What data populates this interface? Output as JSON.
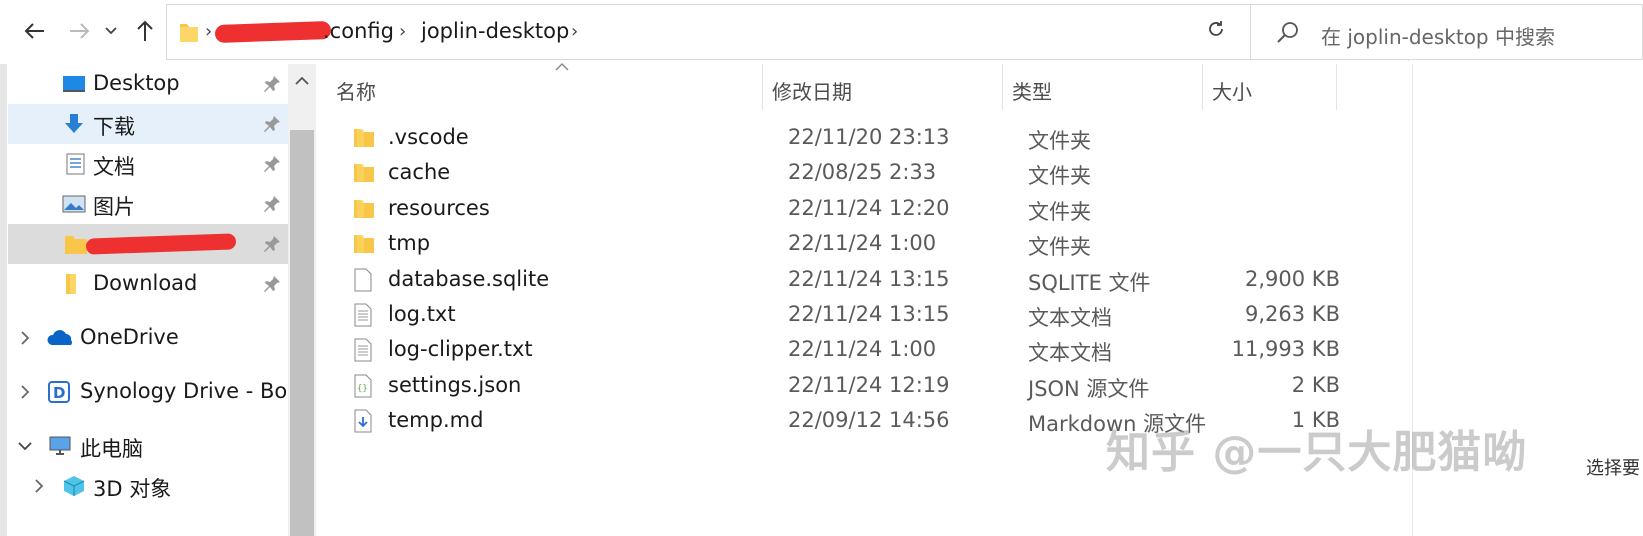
{
  "address_bar": {
    "breadcrumbs": [
      ".config",
      "joplin-desktop"
    ],
    "search_placeholder": "在 joplin-desktop 中搜索"
  },
  "sidebar": {
    "quick_access": [
      {
        "label": "Desktop",
        "icon": "desktop-icon",
        "pinned": true
      },
      {
        "label": "下载",
        "icon": "download-arrow-icon",
        "pinned": true,
        "selected": true
      },
      {
        "label": "文档",
        "icon": "document-icon",
        "pinned": true
      },
      {
        "label": "图片",
        "icon": "picture-icon",
        "pinned": true
      },
      {
        "label": "",
        "icon": "folder-icon",
        "pinned": true,
        "redacted": true
      },
      {
        "label": "Download",
        "icon": "folder-icon",
        "pinned": true
      }
    ],
    "locations": [
      {
        "label": "OneDrive",
        "icon": "onedrive-cloud-icon",
        "expanded": false
      },
      {
        "label": "Synology Drive - Bor",
        "icon": "synology-drive-icon",
        "expanded": false
      },
      {
        "label": "此电脑",
        "icon": "computer-icon",
        "expanded": true
      },
      {
        "label": "3D 对象",
        "icon": "3d-objects-icon",
        "expanded": false
      }
    ]
  },
  "file_list": {
    "columns": {
      "name": "名称",
      "date": "修改日期",
      "type": "类型",
      "size": "大小"
    },
    "rows": [
      {
        "name": ".vscode",
        "date": "22/11/20 23:13",
        "type": "文件夹",
        "size": "",
        "icon": "folder-icon"
      },
      {
        "name": "cache",
        "date": "22/08/25 2:33",
        "type": "文件夹",
        "size": "",
        "icon": "folder-icon"
      },
      {
        "name": "resources",
        "date": "22/11/24 12:20",
        "type": "文件夹",
        "size": "",
        "icon": "folder-icon"
      },
      {
        "name": "tmp",
        "date": "22/11/24 1:00",
        "type": "文件夹",
        "size": "",
        "icon": "folder-icon"
      },
      {
        "name": "database.sqlite",
        "date": "22/11/24 13:15",
        "type": "SQLITE 文件",
        "size": "2,900 KB",
        "icon": "blank-file-icon"
      },
      {
        "name": "log.txt",
        "date": "22/11/24 13:15",
        "type": "文本文档",
        "size": "9,263 KB",
        "icon": "text-file-icon"
      },
      {
        "name": "log-clipper.txt",
        "date": "22/11/24 1:00",
        "type": "文本文档",
        "size": "11,993 KB",
        "icon": "text-file-icon"
      },
      {
        "name": "settings.json",
        "date": "22/11/24 12:19",
        "type": "JSON 源文件",
        "size": "2 KB",
        "icon": "json-file-icon"
      },
      {
        "name": "temp.md",
        "date": "22/09/12 14:56",
        "type": "Markdown 源文件",
        "size": "1 KB",
        "icon": "markdown-file-icon"
      }
    ]
  },
  "watermark": "知乎 @一只大肥猫呦",
  "status_partial": "选择要",
  "colors": {
    "folder": "#f8c74a",
    "selected_bg": "#e5f0fb",
    "hover_bg": "#dcdcdc",
    "onedrive": "#0a64c8",
    "redaction": "#ee3030"
  }
}
